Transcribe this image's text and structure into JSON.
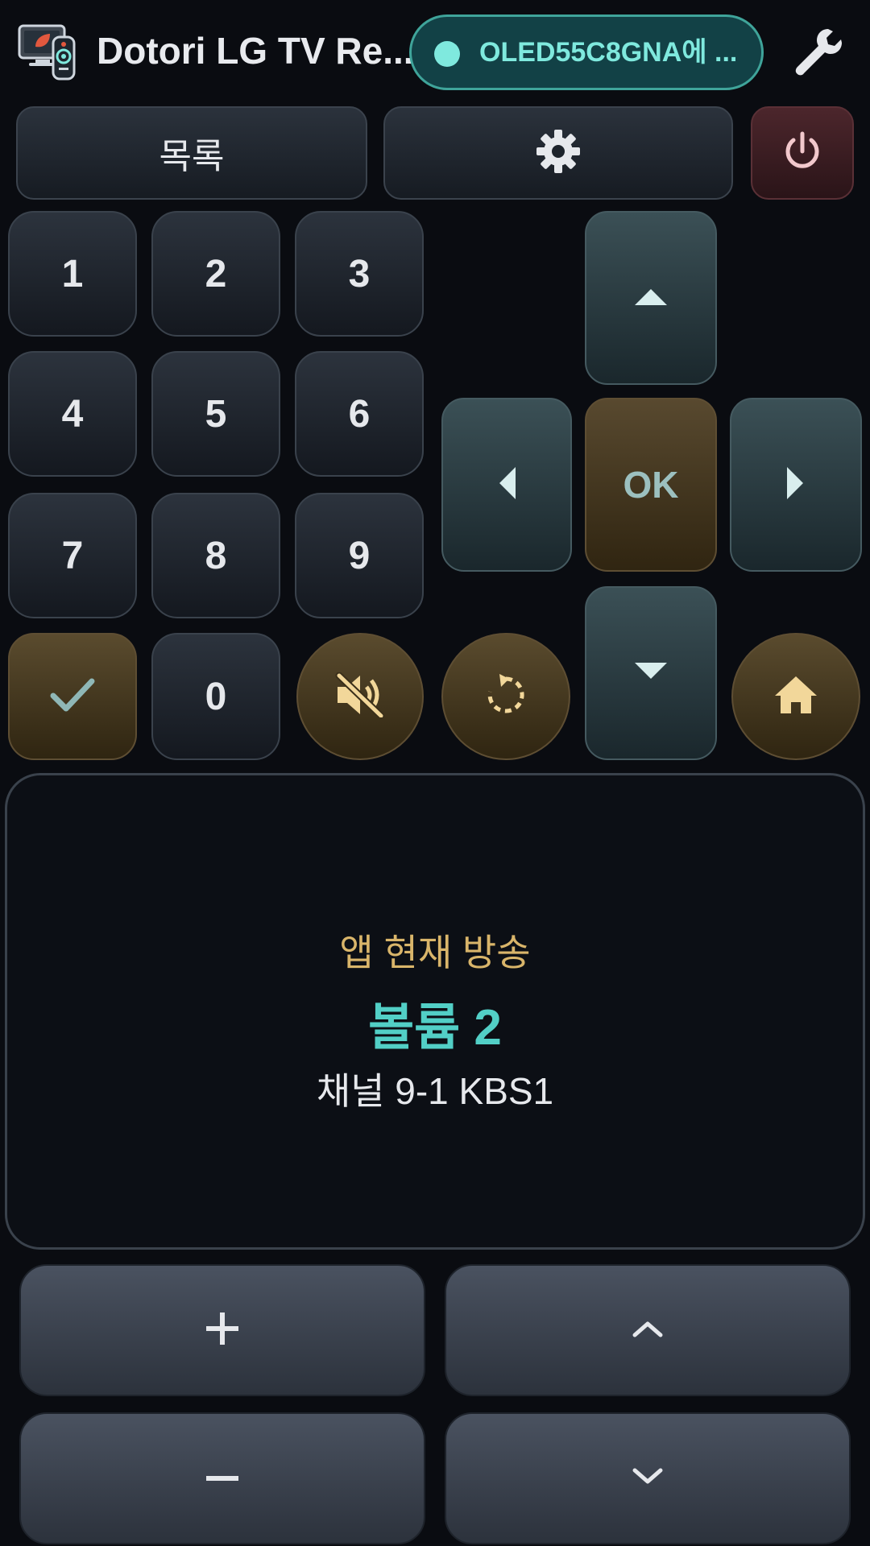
{
  "header": {
    "app_title": "Dotori LG TV Re...",
    "connection_text": "OLED55C8GNA에 ...",
    "connection_color": "#7fe9de"
  },
  "top_row": {
    "list_label": "목록",
    "settings_icon": "gear-icon",
    "power_icon": "power-icon"
  },
  "numpad": {
    "keys": [
      "1",
      "2",
      "3",
      "4",
      "5",
      "6",
      "7",
      "8",
      "9",
      "0"
    ]
  },
  "dpad": {
    "ok_label": "OK"
  },
  "status": {
    "app_line": "앱 현재 방송",
    "volume_line": "볼륨 2",
    "channel_line": "채널 9-1 KBS1"
  },
  "colors": {
    "accent_gold": "#d9b56a",
    "accent_teal": "#52cfc6",
    "background": "#0a0c11"
  }
}
